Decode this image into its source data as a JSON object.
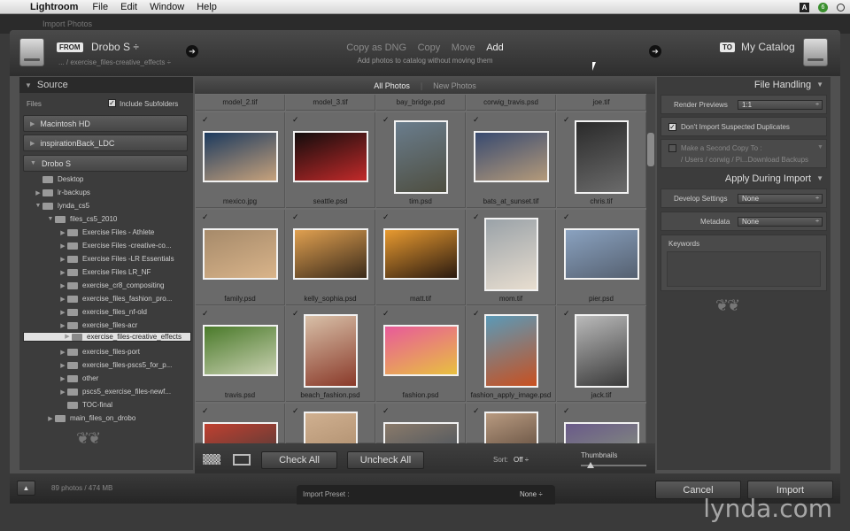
{
  "menubar": {
    "apple": "",
    "app": "Lightroom",
    "items": [
      "File",
      "Edit",
      "Window",
      "Help"
    ],
    "right_icons": [
      "adobe-icon",
      "sync-icon",
      "spotlight-icon"
    ]
  },
  "window_title": "Import Photos",
  "top": {
    "from_tag": "FROM",
    "source_name": "Drobo S ÷",
    "source_path": "... / exercise_files-creative_effects ÷",
    "modes": [
      "Copy as DNG",
      "Copy",
      "Move",
      "Add"
    ],
    "active_mode": "Add",
    "mode_description": "Add photos to catalog without moving them",
    "to_tag": "TO",
    "destination": "My Catalog"
  },
  "source_panel": {
    "title": "Source",
    "files_label": "Files",
    "include_subfolders": "Include Subfolders",
    "volumes": [
      "Macintosh HD",
      "inspirationBack_LDC",
      "Drobo S"
    ],
    "folders": [
      {
        "name": "Desktop",
        "depth": 1,
        "expanded": false,
        "has_children": false
      },
      {
        "name": "lr-backups",
        "depth": 1,
        "expanded": false,
        "has_children": true
      },
      {
        "name": "lynda_cs5",
        "depth": 1,
        "expanded": true,
        "has_children": true
      },
      {
        "name": "files_cs5_2010",
        "depth": 2,
        "expanded": true,
        "has_children": true
      },
      {
        "name": "Exercise Files - Athlete",
        "depth": 3,
        "expanded": false,
        "has_children": true
      },
      {
        "name": "Exercise Files -creative-co...",
        "depth": 3,
        "expanded": false,
        "has_children": true
      },
      {
        "name": "Exercise Files -LR Essentials",
        "depth": 3,
        "expanded": false,
        "has_children": true
      },
      {
        "name": "Exercise Files LR_NF",
        "depth": 3,
        "expanded": false,
        "has_children": true
      },
      {
        "name": "exercise_cr8_compositing",
        "depth": 3,
        "expanded": false,
        "has_children": true
      },
      {
        "name": "exercise_files_fashion_pro...",
        "depth": 3,
        "expanded": false,
        "has_children": true
      },
      {
        "name": "exercise_files_nf-old",
        "depth": 3,
        "expanded": false,
        "has_children": true
      },
      {
        "name": "exercise_files-acr",
        "depth": 3,
        "expanded": false,
        "has_children": true
      },
      {
        "name": "exercise_files-creative_effects",
        "depth": 3,
        "expanded": false,
        "has_children": true,
        "selected": true
      },
      {
        "name": "exercise_files-port",
        "depth": 3,
        "expanded": false,
        "has_children": true
      },
      {
        "name": "exercise_files-pscs5_for_p...",
        "depth": 3,
        "expanded": false,
        "has_children": true
      },
      {
        "name": "other",
        "depth": 3,
        "expanded": false,
        "has_children": true
      },
      {
        "name": "pscs5_exercise_files-newf...",
        "depth": 3,
        "expanded": false,
        "has_children": true
      },
      {
        "name": "TOC-final",
        "depth": 3,
        "expanded": false,
        "has_children": false
      },
      {
        "name": "main_files_on_drobo",
        "depth": 2,
        "expanded": false,
        "has_children": true
      }
    ]
  },
  "grid": {
    "tabs": [
      "All Photos",
      "New Photos"
    ],
    "active_tab": "All Photos",
    "top_row": [
      "model_2.tif",
      "model_3.tif",
      "bay_bridge.psd",
      "corwig_travis.psd",
      "joe.tif"
    ],
    "rows": [
      [
        {
          "name": "mexico.jpg",
          "orient": "land",
          "c1": "#1c3a5e",
          "c2": "#c7a27c"
        },
        {
          "name": "seattle.psd",
          "orient": "land",
          "c1": "#120c0c",
          "c2": "#c22a2a"
        },
        {
          "name": "tim.psd",
          "orient": "port",
          "c1": "#6a7d8d",
          "c2": "#4e4e40"
        },
        {
          "name": "bats_at_sunset.tif",
          "orient": "land",
          "c1": "#384a70",
          "c2": "#b49a7a"
        },
        {
          "name": "chris.tif",
          "orient": "port",
          "c1": "#2a2a2a",
          "c2": "#6b6b6b"
        }
      ],
      [
        {
          "name": "family.psd",
          "orient": "land",
          "c1": "#a68a6a",
          "c2": "#d9b48a"
        },
        {
          "name": "kelly_sophia.psd",
          "orient": "land",
          "c1": "#e0a050",
          "c2": "#3a2a1a"
        },
        {
          "name": "matt.tif",
          "orient": "land",
          "c1": "#e89a30",
          "c2": "#2a1a10"
        },
        {
          "name": "mom.tif",
          "orient": "port",
          "c1": "#9aa2a8",
          "c2": "#e8ded0"
        },
        {
          "name": "pier.psd",
          "orient": "land",
          "c1": "#8aa2c0",
          "c2": "#556070"
        }
      ],
      [
        {
          "name": "travis.psd",
          "orient": "land",
          "c1": "#4a7a2a",
          "c2": "#c8d0b0"
        },
        {
          "name": "beach_fashion.psd",
          "orient": "port",
          "c1": "#d8c0a8",
          "c2": "#8a3a2a"
        },
        {
          "name": "fashion.psd",
          "orient": "land",
          "c1": "#e85a9a",
          "c2": "#e8c040"
        },
        {
          "name": "fashion_apply_image.psd",
          "orient": "port",
          "c1": "#5a9ab8",
          "c2": "#c85020"
        },
        {
          "name": "jack.tif",
          "orient": "port",
          "c1": "#bababa",
          "c2": "#3a3a3a"
        }
      ],
      [
        {
          "name": "",
          "orient": "land",
          "c1": "#c04030",
          "c2": "#3a3a3a"
        },
        {
          "name": "",
          "orient": "port",
          "c1": "#d0b090",
          "c2": "#a08060"
        },
        {
          "name": "",
          "orient": "land",
          "c1": "#8a7a6a",
          "c2": "#3a4a5a"
        },
        {
          "name": "",
          "orient": "port",
          "c1": "#b89a80",
          "c2": "#3a2a20"
        },
        {
          "name": "",
          "orient": "land",
          "c1": "#6a5a8a",
          "c2": "#8a9a7a"
        }
      ]
    ]
  },
  "grid_toolbar": {
    "check_all": "Check All",
    "uncheck_all": "Uncheck All",
    "sort_label": "Sort:",
    "sort_value": "Off ÷",
    "thumbnails_label": "Thumbnails",
    "thumbnail_size": 0.15
  },
  "file_handling": {
    "title": "File Handling",
    "render_previews_label": "Render Previews",
    "render_previews_value": "1:1",
    "dont_import_dupes": "Don't Import Suspected Duplicates",
    "second_copy_label": "Make a Second Copy To :",
    "second_copy_path": "/ Users / corwig / Pi...Download Backups"
  },
  "apply_during_import": {
    "title": "Apply During Import",
    "develop_label": "Develop Settings",
    "develop_value": "None",
    "metadata_label": "Metadata",
    "metadata_value": "None",
    "keywords_label": "Keywords"
  },
  "bottom": {
    "count": "89 photos / 474 MB",
    "preset_label": "Import Preset :",
    "preset_value": "None ÷",
    "cancel": "Cancel",
    "import": "Import"
  },
  "watermark": "lynda.com"
}
